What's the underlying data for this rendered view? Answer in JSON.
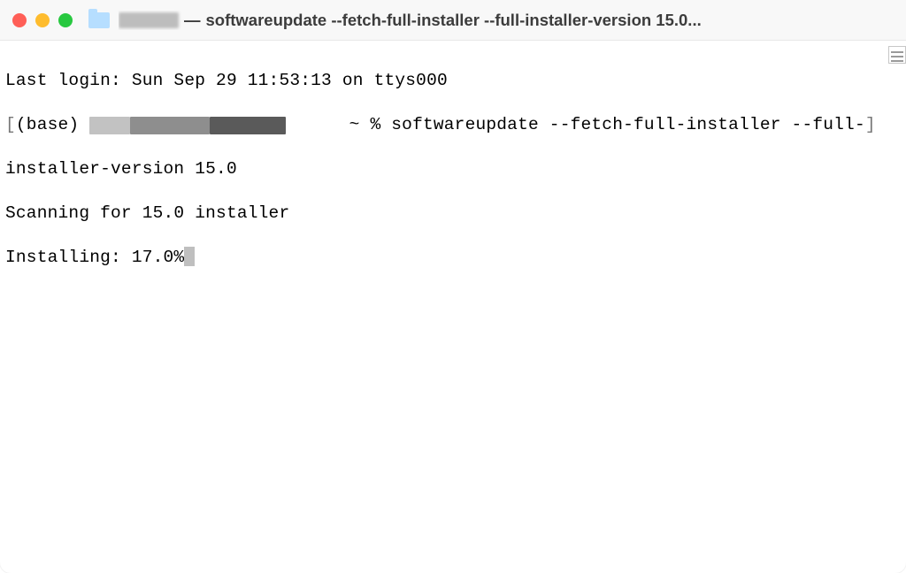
{
  "window": {
    "title_prefix_redacted": true,
    "title_separator": " — ",
    "title_command": "softwareupdate --fetch-full-installer --full-installer-version 15.0",
    "title_truncated": true
  },
  "terminal": {
    "last_login_line": "Last login: Sun Sep 29 11:53:13 on ttys000",
    "prompt_env": "(base) ",
    "prompt_tail": " ~ % ",
    "command_segment_1": "softwareupdate --fetch-full-installer --full-",
    "command_segment_2": "installer-version 15.0",
    "scan_line": "Scanning for 15.0 installer",
    "install_label": "Installing: ",
    "install_percent": "17.0%"
  }
}
